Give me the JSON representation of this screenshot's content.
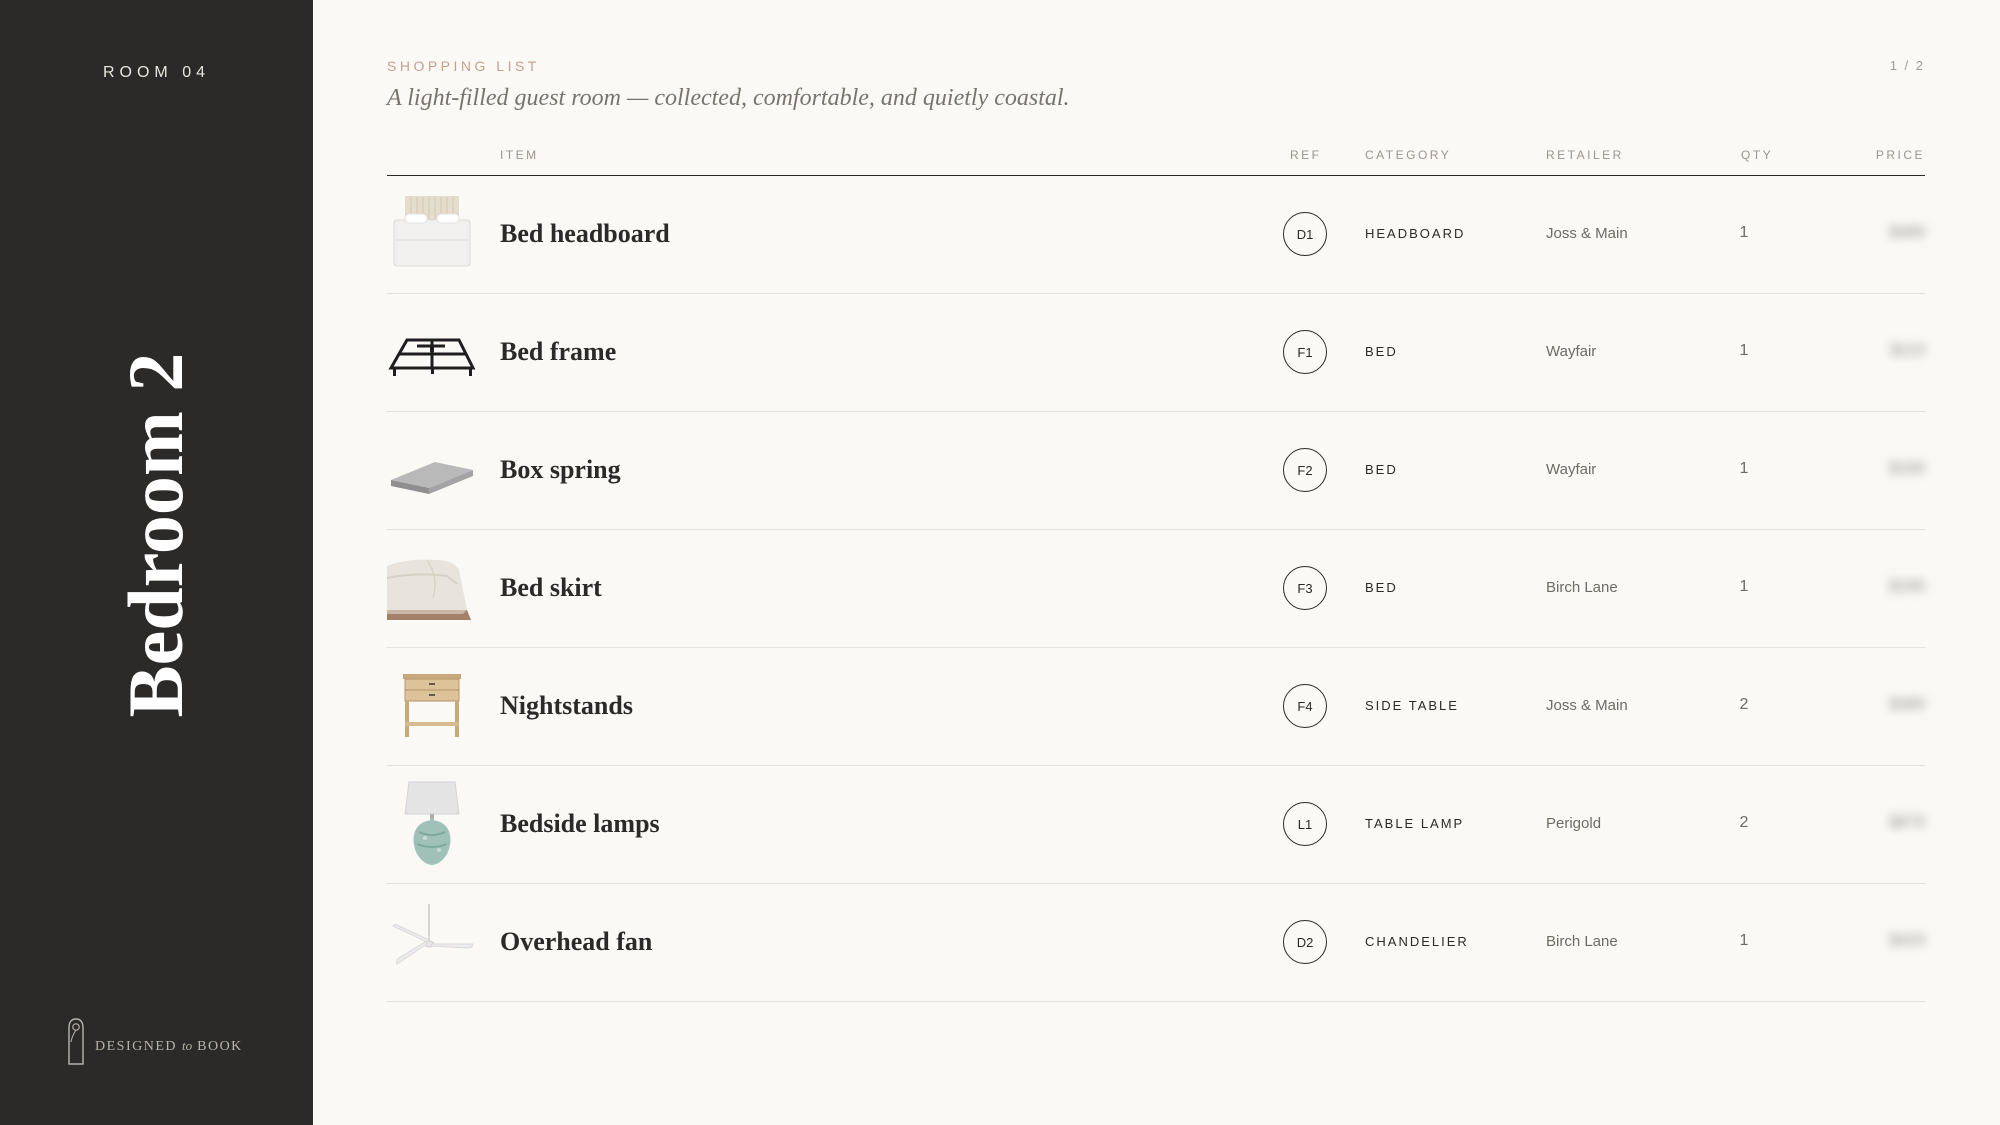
{
  "sidebar": {
    "room_label": "ROOM 04",
    "room_name": "Bedroom 2",
    "logo": {
      "part1": "DESIGNED",
      "part2": "to",
      "part3": "BOOK"
    }
  },
  "header": {
    "kicker": "SHOPPING LIST",
    "tagline": "A light-filled guest room — collected, comfortable, and quietly coastal.",
    "page": "1 / 2"
  },
  "table": {
    "columns": {
      "item": "ITEM",
      "ref": "REF",
      "category": "CATEGORY",
      "retailer": "RETAILER",
      "qty": "QTY",
      "price": "PRICE"
    },
    "rows": [
      {
        "image": "headboard-thumbnail",
        "item": "Bed headboard",
        "ref": "D1",
        "category": "HEADBOARD",
        "retailer": "Joss & Main",
        "qty": "1",
        "price": "$489"
      },
      {
        "image": "bed-frame-thumbnail",
        "item": "Bed frame",
        "ref": "F1",
        "category": "BED",
        "retailer": "Wayfair",
        "qty": "1",
        "price": "$119"
      },
      {
        "image": "box-spring-thumbnail",
        "item": "Box spring",
        "ref": "F2",
        "category": "BED",
        "retailer": "Wayfair",
        "qty": "1",
        "price": "$169"
      },
      {
        "image": "bed-skirt-thumbnail",
        "item": "Bed skirt",
        "ref": "F3",
        "category": "BED",
        "retailer": "Birch Lane",
        "qty": "1",
        "price": "$189"
      },
      {
        "image": "nightstand-thumbnail",
        "item": "Nightstands",
        "ref": "F4",
        "category": "SIDE TABLE",
        "retailer": "Joss & Main",
        "qty": "2",
        "price": "$389"
      },
      {
        "image": "table-lamp-thumbnail",
        "item": "Bedside lamps",
        "ref": "L1",
        "category": "TABLE LAMP",
        "retailer": "Perigold",
        "qty": "2",
        "price": "$879"
      },
      {
        "image": "ceiling-fan-thumbnail",
        "item": "Overhead fan",
        "ref": "D2",
        "category": "CHANDELIER",
        "retailer": "Birch Lane",
        "qty": "1",
        "price": "$429"
      }
    ]
  }
}
